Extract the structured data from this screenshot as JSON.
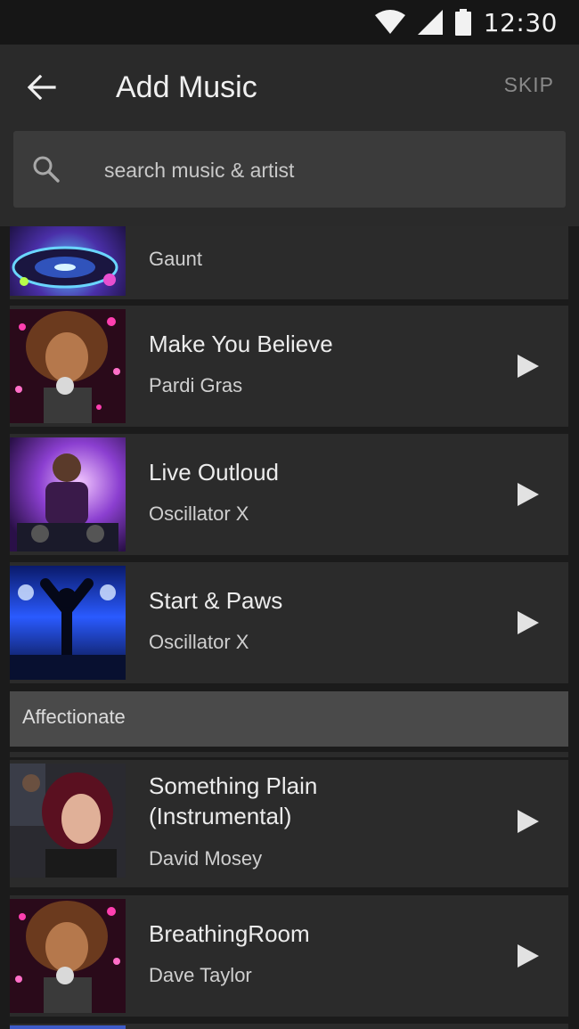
{
  "status_bar": {
    "time": "12:30",
    "icons": [
      "wifi-icon",
      "cell-signal-icon",
      "battery-icon"
    ]
  },
  "app_bar": {
    "title": "Add Music",
    "back_icon": "arrow-back-icon",
    "skip_label": "SKIP"
  },
  "search": {
    "placeholder": "search music & artist",
    "value": "",
    "icon": "search-icon"
  },
  "tracks_top": [
    {
      "title": "",
      "artist": "Gaunt",
      "cover": "dj-turntable"
    },
    {
      "title": "Make You Believe",
      "artist": "Pardi Gras",
      "cover": "singer-woman"
    },
    {
      "title": "Live Outloud",
      "artist": "Oscillator X",
      "cover": "dj-man"
    },
    {
      "title": "Start & Paws",
      "artist": "Oscillator X",
      "cover": "concert-crowd"
    }
  ],
  "section": {
    "label": "Affectionate"
  },
  "tracks_bottom": [
    {
      "title_line1": "Something Plain",
      "title_line2": "(Instrumental)",
      "artist": "David Mosey",
      "cover": "woman-singing"
    },
    {
      "title": "BreathingRoom",
      "artist": "Dave Taylor",
      "cover": "singer-woman"
    }
  ],
  "colors": {
    "background": "#1b1b1b",
    "status_bar": "#161616",
    "app_bar": "#2a2a2a",
    "search_box": "#3b3b3b",
    "list_item": "#2b2b2b",
    "section_header": "#4a4a4a",
    "skip_text": "#8a8a8a"
  }
}
